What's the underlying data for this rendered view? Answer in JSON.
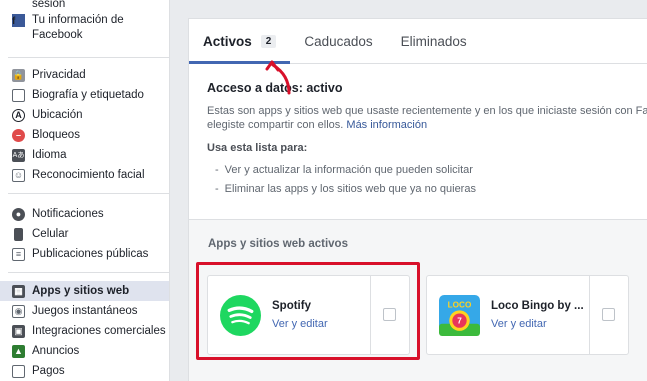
{
  "sidebar": {
    "top_partial": "sesión",
    "facebook_info": "Tu información de Facebook",
    "group1": [
      "Privacidad",
      "Biografía y etiquetado",
      "Ubicación",
      "Bloqueos",
      "Idioma",
      "Reconocimiento facial"
    ],
    "group2": [
      "Notificaciones",
      "Celular",
      "Publicaciones públicas"
    ],
    "group3": [
      "Apps y sitios web",
      "Juegos instantáneos",
      "Integraciones comerciales",
      "Anuncios",
      "Pagos"
    ]
  },
  "tabs": {
    "active": "Activos",
    "active_count": "2",
    "expired": "Caducados",
    "removed": "Eliminados"
  },
  "content": {
    "heading": "Acceso a datos: activo",
    "desc_line1": "Estas son apps y sitios web que usaste recientemente y en los que iniciaste sesión con Face",
    "desc_line2": "elegiste compartir con ellos.",
    "more_info": "Más información",
    "use_list": "Usa esta lista para:",
    "bullet1": "Ver y actualizar la información que pueden solicitar",
    "bullet2": "Eliminar las apps y los sitios web que ya no quieras"
  },
  "apps": {
    "section_title": "Apps y sitios web activos",
    "items": [
      {
        "name": "Spotify",
        "action": "Ver y editar",
        "icon": "spotify-logo"
      },
      {
        "name": "Loco Bingo by ...",
        "action": "Ver y editar",
        "icon": "loco-bingo-logo"
      }
    ]
  },
  "colors": {
    "accent": "#4267b2",
    "highlight": "#d8102a",
    "spotify": "#1ed760"
  }
}
